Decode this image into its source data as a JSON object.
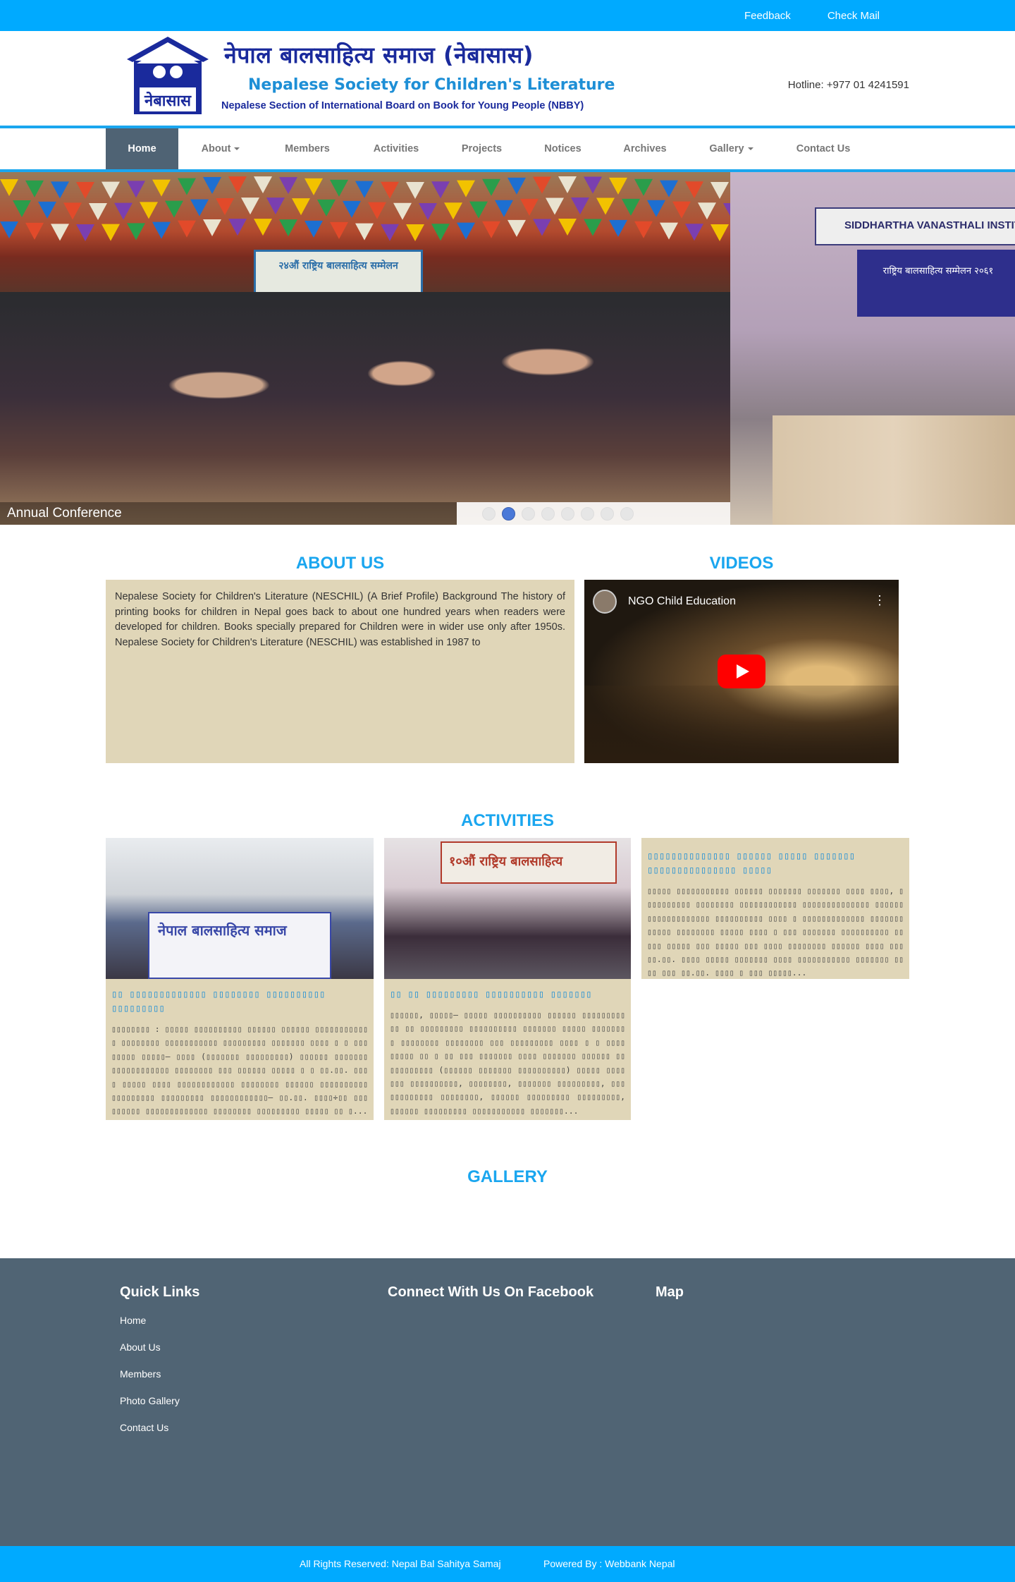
{
  "topbar": {
    "links": [
      "Feedback",
      "Check Mail"
    ]
  },
  "header": {
    "logo_emblem_text": "नेबासास",
    "title_nepali": "नेपाल बालसाहित्य समाज (नेबासास)",
    "title_english": "Nepalese Society for Children's Literature",
    "subtitle": "Nepalese Section of International Board on Book for Young People (NBBY)",
    "hotline": "Hotline: +977 01 4241591"
  },
  "nav": {
    "items": [
      {
        "label": "Home",
        "active": true,
        "dropdown": false
      },
      {
        "label": "About",
        "active": false,
        "dropdown": true
      },
      {
        "label": "Members",
        "active": false,
        "dropdown": false
      },
      {
        "label": "Activities",
        "active": false,
        "dropdown": false
      },
      {
        "label": "Projects",
        "active": false,
        "dropdown": false
      },
      {
        "label": "Notices",
        "active": false,
        "dropdown": false
      },
      {
        "label": "Archives",
        "active": false,
        "dropdown": false
      },
      {
        "label": "Gallery",
        "active": false,
        "dropdown": true
      },
      {
        "label": "Contact Us",
        "active": false,
        "dropdown": false
      }
    ]
  },
  "slider": {
    "caption": "Annual Conference",
    "slide1_banner_text": "२४औं राष्ट्रिय बालसाहित्य सम्मेलन",
    "slide2_sign_text": "SIDDHARTHA VANASTHALI INSTIT",
    "slide2_banner_text": "राष्ट्रिय बालसाहित्य सम्मेलन २०६१",
    "dot_count": 8,
    "active_dot": 2
  },
  "about": {
    "title": "ABOUT US",
    "text": "Nepalese Society for Children's Literature (NESCHIL) (A Brief Profile) Background The history of printing books for children in Nepal goes back to about one hundred years when readers were developed for children. Books specially prepared for Children were in wider use only after 1950s.  Nepalese Society for Children's Literature (NESCHIL) was established in 1987 to"
  },
  "videos": {
    "title": "VIDEOS",
    "video_title": "NGO Child Education"
  },
  "activities": {
    "title": "ACTIVITIES",
    "items": [
      {
        "image_banner": "नेपाल बालसाहित्य समाज",
        "heading": "▯▯ ▯▯▯▯▯▯▯▯▯▯▯▯▯ ▯▯▯▯▯▯▯▯ ▯▯▯▯▯▯▯▯▯▯ ▯▯▯▯▯▯▯▯▯",
        "text": "▯▯▯▯▯▯▯▯ : ▯▯▯▯▯ ▯▯▯▯▯▯▯▯▯▯ ▯▯▯▯▯▯ ▯▯▯▯▯▯ ▯▯▯▯▯▯▯▯▯▯▯▯ ▯▯▯▯▯▯▯▯ ▯▯▯▯▯▯▯▯▯▯▯ ▯▯▯▯▯▯▯▯▯ ▯▯▯▯▯▯▯ ▯▯▯▯ ▯ ▯ ▯▯▯▯▯▯▯▯ ▯▯▯▯▯– ▯▯▯▯ (▯▯▯▯▯▯▯ ▯▯▯▯▯▯▯▯▯) ▯▯▯▯▯▯ ▯▯▯▯▯▯▯ ▯▯▯▯▯▯▯▯▯▯▯▯ ▯▯▯▯▯▯▯▯ ▯▯▯ ▯▯▯▯▯▯ ▯▯▯▯▯ ▯ ▯ ▯▯.▯▯. ▯▯▯▯ ▯▯▯▯▯ ▯▯▯▯ ▯▯▯▯▯▯▯▯▯▯▯▯ ▯▯▯▯▯▯▯▯ ▯▯▯▯▯▯ ▯▯▯▯▯▯▯▯▯▯ ▯▯▯▯▯▯▯▯▯ ▯▯▯▯▯▯▯▯▯ ▯▯▯▯▯▯▯▯▯▯▯▯– ▯▯.▯▯. ▯▯▯▯÷▯▯ ▯▯▯ ▯▯▯▯▯▯ ▯▯▯▯▯▯▯▯▯▯▯▯▯ ▯▯▯▯▯▯▯▯ ▯▯▯▯▯▯▯▯▯ ▯▯▯▯▯ ▯▯ ▯..."
      },
      {
        "image_banner": "१०औं राष्ट्रिय बालसाहित्य",
        "heading": "▯▯ ▯▯ ▯▯▯▯▯▯▯▯▯ ▯▯▯▯▯▯▯▯▯▯ ▯▯▯▯▯▯▯",
        "text": "▯▯▯▯▯▯, ▯▯▯▯▯– ▯▯▯▯▯ ▯▯▯▯▯▯▯▯▯▯ ▯▯▯▯▯▯ ▯▯▯▯▯▯▯▯▯ ▯▯ ▯▯ ▯▯▯▯▯▯▯▯▯ ▯▯▯▯▯▯▯▯▯▯ ▯▯▯▯▯▯▯ ▯▯▯▯▯ ▯▯▯▯▯▯▯▯ ▯▯▯▯▯▯▯▯ ▯▯▯▯▯▯▯▯ ▯▯▯ ▯▯▯▯▯▯▯▯▯ ▯▯▯▯ ▯ ▯ ▯▯▯▯ ▯▯▯▯▯ ▯▯ ▯ ▯▯ ▯▯▯ ▯▯▯▯▯▯▯ ▯▯▯▯ ▯▯▯▯▯▯▯ ▯▯▯▯▯▯ ▯▯▯▯▯▯▯▯▯▯▯ (▯▯▯▯▯▯ ▯▯▯▯▯▯▯ ▯▯▯▯▯▯▯▯▯▯) ▯▯▯▯▯ ▯▯▯▯▯▯▯ ▯▯▯▯▯▯▯▯▯▯, ▯▯▯▯▯▯▯▯, ▯▯▯▯▯▯▯ ▯▯▯▯▯▯▯▯▯, ▯▯▯▯▯▯▯▯▯▯▯▯ ▯▯▯▯▯▯▯▯, ▯▯▯▯▯▯ ▯▯▯▯▯▯▯▯▯ ▯▯▯▯▯▯▯▯▯, ▯▯▯▯▯▯ ▯▯▯▯▯▯▯▯▯ ▯▯▯▯▯▯▯▯▯▯▯ ▯▯▯▯▯▯▯..."
      },
      {
        "heading": "▯▯▯▯▯▯▯▯▯▯▯▯▯▯ ▯▯▯▯▯▯ ▯▯▯▯▯ ▯▯▯▯▯▯▯ ▯▯▯▯▯▯▯▯▯▯▯▯▯▯▯ ▯▯▯▯▯",
        "text": "▯▯▯▯▯ ▯▯▯▯▯▯▯▯▯▯▯ ▯▯▯▯▯▯ ▯▯▯▯▯▯▯ ▯▯▯▯▯▯▯ ▯▯▯▯ ▯▯▯▯, ▯▯▯▯▯▯▯▯▯▯ ▯▯▯▯▯▯▯▯ ▯▯▯▯▯▯▯▯▯▯▯▯ ▯▯▯▯▯▯▯▯▯▯▯▯▯▯ ▯▯▯▯▯▯ ▯▯▯▯▯▯▯▯▯▯▯▯▯ ▯▯▯▯▯▯▯▯▯▯ ▯▯▯▯ ▯ ▯▯▯▯▯▯▯▯▯▯▯▯▯ ▯▯▯▯▯▯▯▯▯▯▯▯ ▯▯▯▯▯▯▯▯ ▯▯▯▯▯ ▯▯▯▯ ▯ ▯▯▯ ▯▯▯▯▯▯▯ ▯▯▯▯▯▯▯▯▯▯ ▯▯▯▯▯ ▯▯▯▯▯ ▯▯▯ ▯▯▯▯▯ ▯▯▯ ▯▯▯▯ ▯▯▯▯▯▯▯▯ ▯▯▯▯▯▯ ▯▯▯▯ ▯▯▯ ▯▯.▯▯. ▯▯▯▯ ▯▯▯▯▯ ▯▯▯▯▯▯▯ ▯▯▯▯ ▯▯▯▯▯▯▯▯▯▯▯ ▯▯▯▯▯▯▯ ▯▯▯▯ ▯▯▯ ▯▯.▯▯. ▯▯▯▯ ▯ ▯▯▯ ▯▯▯▯▯..."
      }
    ]
  },
  "gallery": {
    "title": "GALLERY"
  },
  "footer": {
    "quick_links_title": "Quick Links",
    "quick_links": [
      "Home",
      "About Us",
      "Members",
      "Photo Gallery",
      "Contact Us"
    ],
    "facebook_title": "Connect With Us On Facebook",
    "map_title": "Map",
    "rights": "All Rights Reserved: Nepal Bal Sahitya Samaj",
    "powered": "Powered By : Webbank Nepal"
  }
}
